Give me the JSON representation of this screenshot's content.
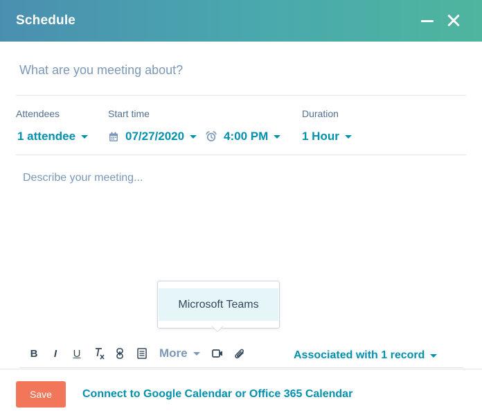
{
  "header": {
    "title": "Schedule",
    "minimize_icon": "minimize-icon",
    "close_icon": "close-icon"
  },
  "subject": {
    "placeholder": "What are you meeting about?",
    "value": ""
  },
  "attendees": {
    "label": "Attendees",
    "value": "1 attendee"
  },
  "start_time": {
    "label": "Start time",
    "date": "07/27/2020",
    "time": "4:00 PM",
    "date_icon": "calendar-icon",
    "time_icon": "alarm-clock-icon"
  },
  "duration": {
    "label": "Duration",
    "value": "1 Hour"
  },
  "description": {
    "placeholder": "Describe your meeting...",
    "value": ""
  },
  "popover": {
    "items": [
      {
        "label": "Microsoft Teams"
      }
    ]
  },
  "toolbar": {
    "bold": "B",
    "italic": "I",
    "underline": "U",
    "more_label": "More",
    "icons": [
      "bold-icon",
      "italic-icon",
      "underline-icon",
      "clear-format-icon",
      "link-icon",
      "snippet-icon",
      "video-icon",
      "attachment-icon"
    ]
  },
  "association": {
    "label": "Associated with 1 record"
  },
  "footer": {
    "save_label": "Save",
    "connect_label": "Connect to Google Calendar or Office 365 Calendar"
  },
  "colors": {
    "header_start": "#4a8fb0",
    "header_end": "#4fb59e",
    "link": "#0091ae",
    "save": "#f2765a",
    "highlight": "#e5f5f8"
  }
}
